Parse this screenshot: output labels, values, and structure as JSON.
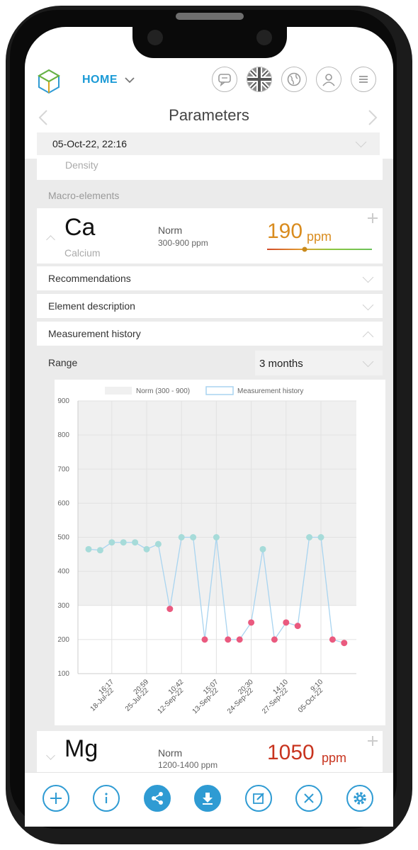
{
  "header": {
    "home_label": "HOME",
    "title": "Parameters",
    "date": "05-Oct-22, 22:16",
    "icons": [
      "logo-cube-icon",
      "chat-icon",
      "uk-flag-icon",
      "globe-icon",
      "user-icon",
      "menu-icon"
    ]
  },
  "sections": {
    "density_label": "Density",
    "macro_label": "Macro-elements"
  },
  "calcium": {
    "symbol": "Ca",
    "name": "Calcium",
    "norm_label": "Norm",
    "norm_range": "300-900 ppm",
    "value": "190",
    "unit": "ppm",
    "value_color": "#d98c1f"
  },
  "rows": {
    "recommendations": "Recommendations",
    "description": "Element description",
    "history": "Measurement history"
  },
  "range": {
    "label": "Range",
    "value": "3 months"
  },
  "magnesium": {
    "symbol": "Mg",
    "norm_label": "Norm",
    "norm_range": "1200-1400 ppm",
    "value": "1050",
    "unit": "ppm",
    "value_color": "#c8341f"
  },
  "bottom_actions": [
    "add-icon",
    "info-icon",
    "share-icon",
    "download-icon",
    "edit-icon",
    "close-icon",
    "settings-icon"
  ],
  "chart_data": {
    "type": "line",
    "legend": [
      "Norm (300 - 900)",
      "Measurement history"
    ],
    "legend_position": "top",
    "ylim": [
      100,
      900
    ],
    "yticks": [
      100,
      200,
      300,
      400,
      500,
      600,
      700,
      800,
      900
    ],
    "norm_band": [
      300,
      900
    ],
    "grid": true,
    "x_tick_labels": [
      {
        "time": "16:17",
        "date": "18-Jul-22"
      },
      {
        "time": "20:59",
        "date": "25-Jul-22"
      },
      {
        "time": "10:42",
        "date": "12-Sep-22"
      },
      {
        "time": "15:07",
        "date": "13-Sep-22"
      },
      {
        "time": "20:30",
        "date": "24-Sep-22"
      },
      {
        "time": "14:10",
        "date": "27-Sep-22"
      },
      {
        "time": "9:10",
        "date": "05-Oct-22"
      }
    ],
    "series": [
      {
        "name": "Measurement history",
        "values": [
          465,
          462,
          485,
          485,
          485,
          465,
          480,
          290,
          500,
          500,
          200,
          500,
          200,
          200,
          250,
          465,
          200,
          250,
          240,
          500,
          500,
          200,
          190
        ]
      }
    ],
    "colors": {
      "in_norm": "#a6dbd9",
      "out_norm": "#ea5a7f",
      "line": "#a8d4f0",
      "band": "#f0f0f0"
    }
  }
}
